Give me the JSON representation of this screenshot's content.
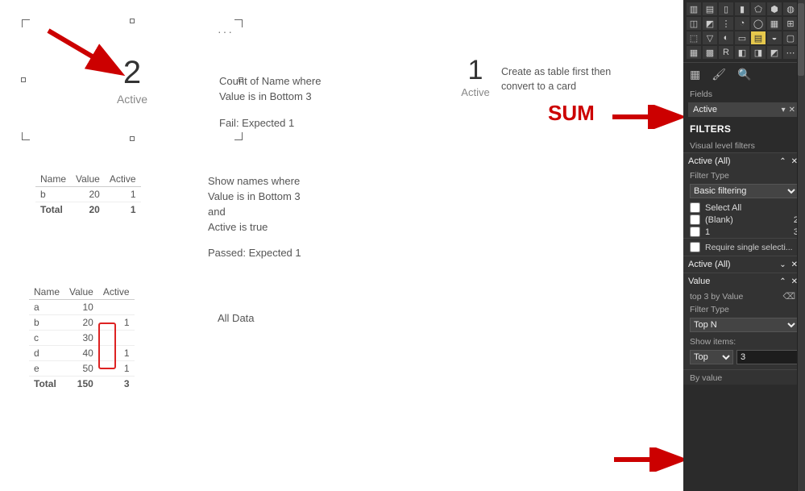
{
  "card_selected": {
    "value": "2",
    "label": "Active"
  },
  "card_right": {
    "value": "1",
    "label": "Active"
  },
  "textbox1": {
    "line1": "Count of Name where",
    "line2": "Value is in Bottom 3",
    "fail": "Fail: Expected 1"
  },
  "textbox2": {
    "line1": "Show names where",
    "line2": "Value is in Bottom 3",
    "line3": "and",
    "line4": "Active is true",
    "passed": "Passed: Expected 1"
  },
  "textbox3": "All Data",
  "textbox4": "Create as table first then convert to a card",
  "sum_annotation": "SUM",
  "table_filtered": {
    "headers": {
      "name": "Name",
      "value": "Value",
      "active": "Active"
    },
    "rows": [
      {
        "name": "b",
        "value": "20",
        "active": "1"
      }
    ],
    "total_label": "Total",
    "total_value": "20",
    "total_active": "1"
  },
  "table_all": {
    "headers": {
      "name": "Name",
      "value": "Value",
      "active": "Active"
    },
    "rows": [
      {
        "name": "a",
        "value": "10",
        "active": ""
      },
      {
        "name": "b",
        "value": "20",
        "active": "1"
      },
      {
        "name": "c",
        "value": "30",
        "active": ""
      },
      {
        "name": "d",
        "value": "40",
        "active": "1"
      },
      {
        "name": "e",
        "value": "50",
        "active": "1"
      }
    ],
    "total_label": "Total",
    "total_value": "150",
    "total_active": "3"
  },
  "viz_icons": [
    "stacked-bar-icon",
    "clustered-bar-icon",
    "stacked-column-icon",
    "clustered-column-icon",
    "line-chart-icon",
    "area-chart-icon",
    "stacked-area-icon",
    "ribbon-chart-icon",
    "waterfall-icon",
    "scatter-icon",
    "pie-chart-icon",
    "donut-chart-icon",
    "treemap-icon",
    "map-icon",
    "filled-map-icon",
    "funnel-icon",
    "gauge-icon",
    "card-icon",
    "multi-row-card-icon",
    "kpi-icon",
    "slicer-icon",
    "table-icon",
    "matrix-icon",
    "r-visual-icon",
    "py-visual-icon",
    "arcgis-icon",
    "key-influencers-icon",
    "more-visuals-icon"
  ],
  "viz_glyphs": [
    "▥",
    "▤",
    "▯",
    "▮",
    "⬠",
    "⬢",
    "◍",
    "◫",
    "◩",
    "⋮",
    "◔",
    "◯",
    "▦",
    "⊞",
    "⬚",
    "▽",
    "◐",
    "▭",
    "▤",
    "◒",
    "▢",
    "▦",
    "▩",
    "R",
    "◧",
    "◨",
    "◩",
    "⋯"
  ],
  "viz_highlight_index": 18,
  "pane_tools": {
    "fields": "Fields",
    "format": "Format",
    "analytics": "Analytics"
  },
  "fields_label": "Fields",
  "field_well": "Active",
  "filters_title": "FILTERS",
  "visual_level_filters_label": "Visual level filters",
  "filter_active": {
    "title": "Active  (All)",
    "filter_type_label": "Filter Type",
    "filter_type_value": "Basic filtering",
    "options": [
      {
        "label": "Select All",
        "count": ""
      },
      {
        "label": "(Blank)",
        "count": "2"
      },
      {
        "label": "1",
        "count": "3"
      }
    ],
    "require_single": "Require single selecti..."
  },
  "filter_active_collapsed": {
    "title": "Active  (All)"
  },
  "filter_value": {
    "title": "Value",
    "subtitle": "top 3 by Value",
    "filter_type_label": "Filter Type",
    "filter_type_value": "Top N",
    "show_items_label": "Show items:",
    "show_items_direction": "Top",
    "show_items_count": "3",
    "by_value_label": "By value"
  }
}
